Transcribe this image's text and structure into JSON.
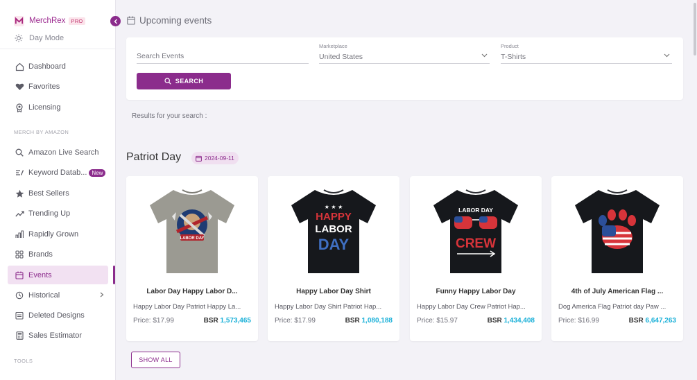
{
  "brand": {
    "name": "MerchRex",
    "tier": "PRO"
  },
  "mode": {
    "label": "Day Mode"
  },
  "sidebar": {
    "top_items": [
      {
        "label": "Dashboard",
        "icon": "home-icon"
      },
      {
        "label": "Favorites",
        "icon": "heart-icon"
      },
      {
        "label": "Licensing",
        "icon": "award-icon"
      }
    ],
    "section_merch": "MERCH BY AMAZON",
    "merch_items": [
      {
        "label": "Amazon Live Search",
        "icon": "search-icon"
      },
      {
        "label": "Keyword Datab...",
        "icon": "keyword-icon",
        "badge": "New"
      },
      {
        "label": "Best Sellers",
        "icon": "star-icon"
      },
      {
        "label": "Trending Up",
        "icon": "trending-up-icon"
      },
      {
        "label": "Rapidly Grown",
        "icon": "chart-icon"
      },
      {
        "label": "Brands",
        "icon": "grid-icon"
      },
      {
        "label": "Events",
        "icon": "calendar-icon",
        "active": true
      },
      {
        "label": "Historical",
        "icon": "history-icon"
      },
      {
        "label": "Deleted Designs",
        "icon": "folder-icon"
      },
      {
        "label": "Sales Estimator",
        "icon": "calculator-icon"
      }
    ],
    "section_tools": "TOOLS"
  },
  "page": {
    "title": "Upcoming events"
  },
  "search": {
    "events_placeholder": "Search Events",
    "marketplace_label": "Marketplace",
    "marketplace_value": "United States",
    "product_label": "Product",
    "product_value": "T-Shirts",
    "button_label": "SEARCH"
  },
  "results_text": "Results for your search :",
  "event": {
    "title": "Patriot Day",
    "date": "2024-09-11",
    "show_all_label": "SHOW ALL",
    "products": [
      {
        "title": "Labor Day Happy Labor D...",
        "desc": "Happy Labor Day Patriot Happy La...",
        "price": "Price: $17.99",
        "bsr_label": "BSR",
        "bsr": "1,573,465",
        "shirt_color": "#9b9a92"
      },
      {
        "title": "Happy Labor Day Shirt",
        "desc": "Happy Labor Day Shirt Patriot Hap...",
        "price": "Price: $17.99",
        "bsr_label": "BSR",
        "bsr": "1,080,188",
        "shirt_color": "#16181c"
      },
      {
        "title": "Funny Happy Labor Day",
        "desc": "Happy Labor Day Crew Patriot Hap...",
        "price": "Price: $15.97",
        "bsr_label": "BSR",
        "bsr": "1,434,408",
        "shirt_color": "#16181c"
      },
      {
        "title": "4th of July American Flag ...",
        "desc": "Dog America Flag Patriot day Paw ...",
        "price": "Price: $16.99",
        "bsr_label": "BSR",
        "bsr": "6,647,263",
        "shirt_color": "#16181c"
      }
    ]
  },
  "colors": {
    "accent": "#8b2c8c",
    "bsr": "#1ab0d8",
    "active_bg": "#f2e1f2"
  }
}
